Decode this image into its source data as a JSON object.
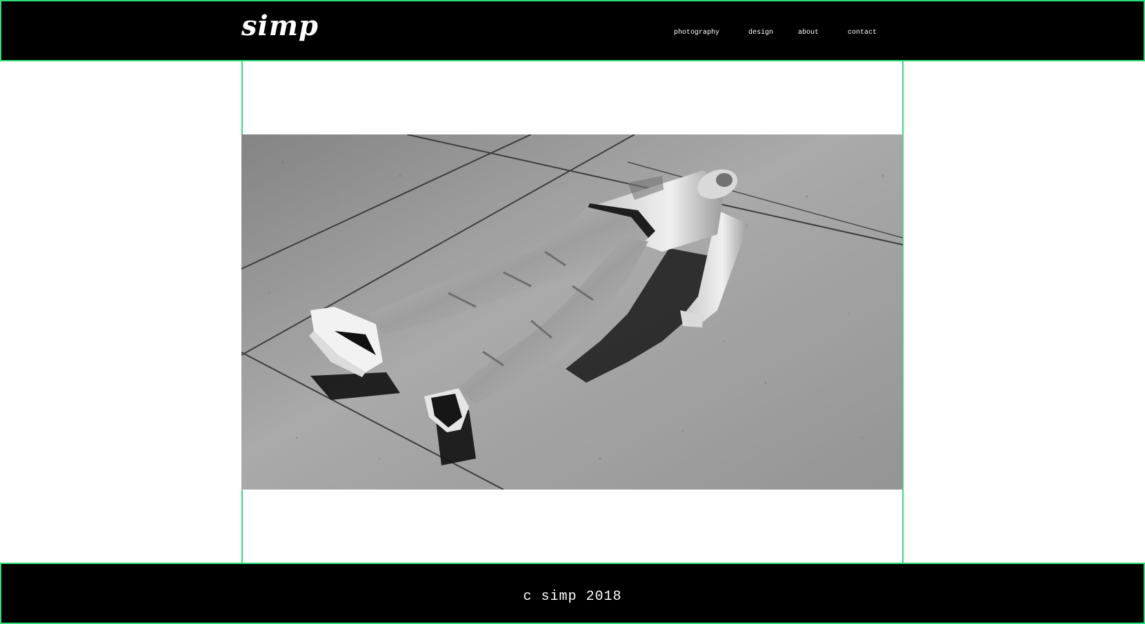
{
  "site": {
    "logo_text": "simp"
  },
  "nav": {
    "photography": "photography",
    "design": "design",
    "about": "about",
    "contact": "contact"
  },
  "photo": {
    "subject": "black-and-white photograph of a shirtless man in jeans lying on a concrete sidewalk"
  },
  "footer": {
    "copyright_text": "c simp 2018"
  },
  "colors": {
    "header_bg": "#000000",
    "footer_bg": "#000000",
    "accent_border": "#2ee07a",
    "page_bg": "#ffffff",
    "text": "#ffffff"
  }
}
